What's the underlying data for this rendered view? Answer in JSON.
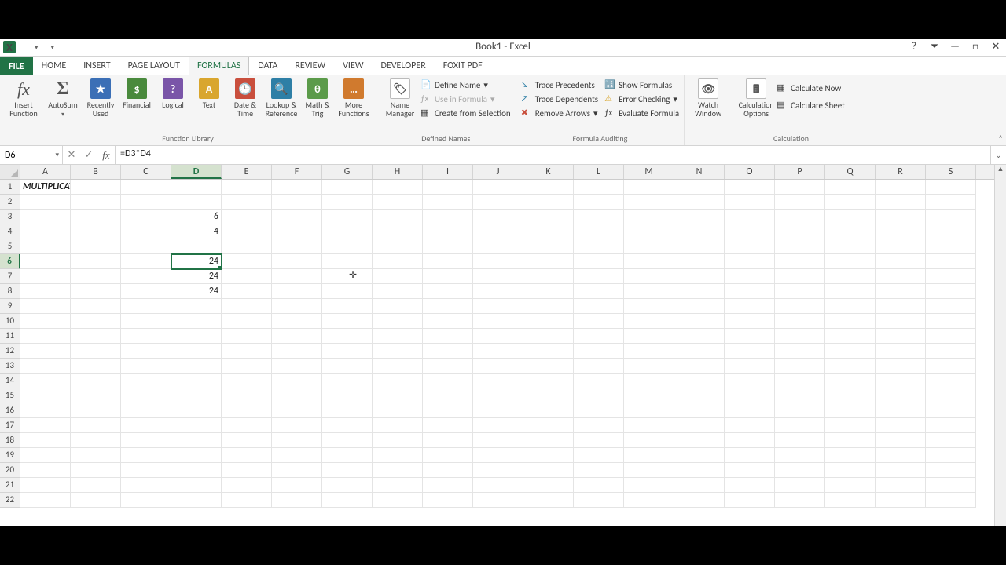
{
  "title": "Book1 - Excel",
  "tabs": {
    "file": "FILE",
    "home": "HOME",
    "insert": "INSERT",
    "page_layout": "PAGE LAYOUT",
    "formulas": "FORMULAS",
    "data": "DATA",
    "review": "REVIEW",
    "view": "VIEW",
    "developer": "DEVELOPER",
    "foxit": "FOXIT PDF"
  },
  "ribbon": {
    "insert_function": "Insert\nFunction",
    "autosum": "AutoSum",
    "recently_used": "Recently\nUsed",
    "financial": "Financial",
    "logical": "Logical",
    "text": "Text",
    "date_time": "Date &\nTime",
    "lookup_ref": "Lookup &\nReference",
    "math_trig": "Math &\nTrig",
    "more_functions": "More\nFunctions",
    "function_library_label": "Function Library",
    "name_manager": "Name\nManager",
    "define_name": "Define Name",
    "use_in_formula": "Use in Formula",
    "create_from_selection": "Create from Selection",
    "defined_names_label": "Defined Names",
    "trace_precedents": "Trace Precedents",
    "trace_dependents": "Trace Dependents",
    "remove_arrows": "Remove Arrows",
    "show_formulas": "Show Formulas",
    "error_checking": "Error Checking",
    "evaluate_formula": "Evaluate Formula",
    "formula_auditing_label": "Formula Auditing",
    "watch_window": "Watch\nWindow",
    "calculation_options": "Calculation\nOptions",
    "calculate_now": "Calculate Now",
    "calculate_sheet": "Calculate Sheet",
    "calculation_label": "Calculation"
  },
  "namebox": "D6",
  "formula": "=D3*D4",
  "columns": [
    "A",
    "B",
    "C",
    "D",
    "E",
    "F",
    "G",
    "H",
    "I",
    "J",
    "K",
    "L",
    "M",
    "N",
    "O",
    "P",
    "Q",
    "R",
    "S"
  ],
  "selected_col": "D",
  "selected_row": 6,
  "cells": {
    "A1": "MULTIPLICATION",
    "D3": "6",
    "D4": "4",
    "D6": "24",
    "D7": "24",
    "D8": "24"
  },
  "row_count": 22,
  "colors": {
    "accent": "#217346"
  }
}
